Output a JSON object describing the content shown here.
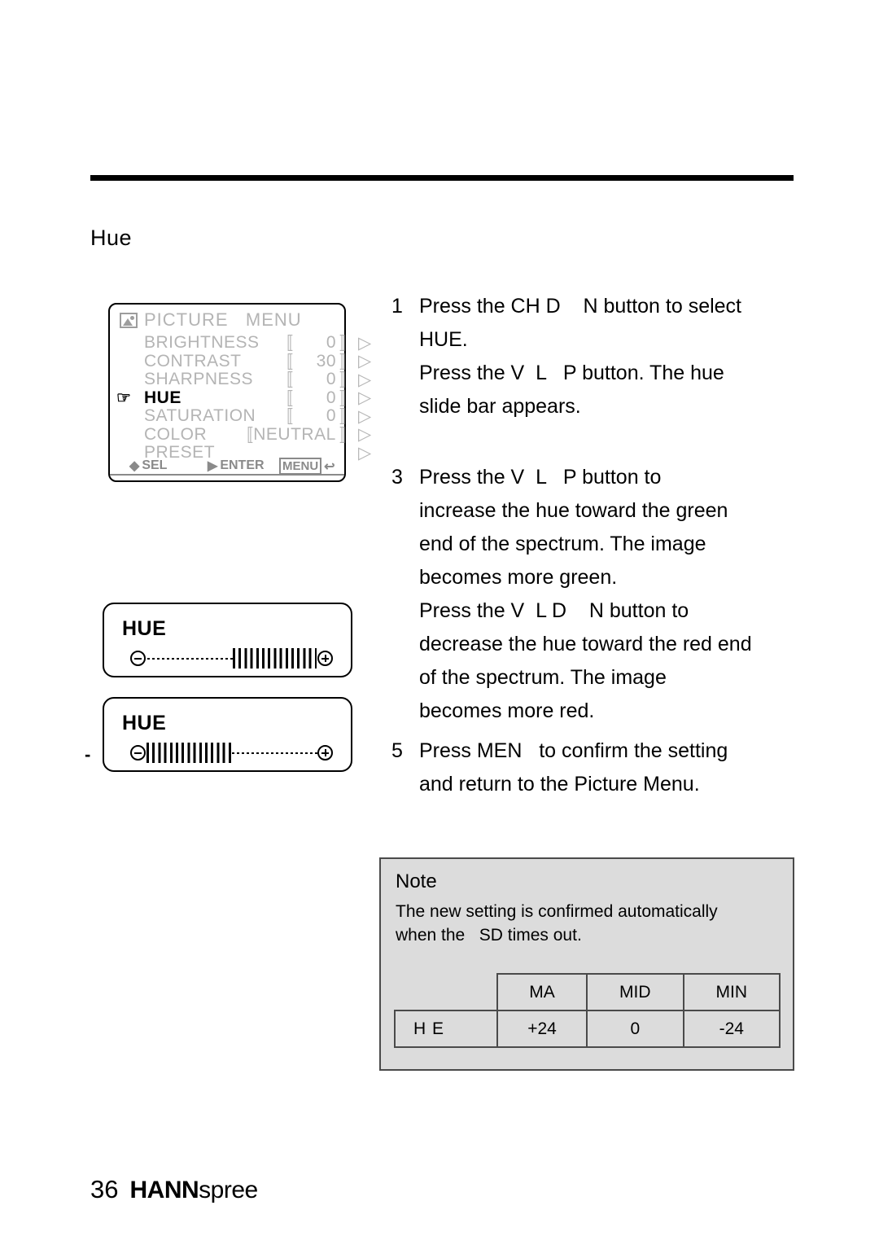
{
  "page": {
    "section_title": "Hue",
    "page_number": "36",
    "brand_bold": "HANN",
    "brand_light": "spree"
  },
  "osd": {
    "icon": "picture-menu-icon",
    "title": "PICTURE   MENU",
    "bracket_left": "〚",
    "bracket_right": "〛",
    "arrow": "▷",
    "cursor_glyph": "☞",
    "rows": [
      {
        "label": "BRIGHTNESS",
        "value": "0",
        "selected": false
      },
      {
        "label": "CONTRAST",
        "value": "30",
        "selected": false
      },
      {
        "label": "SHARPNESS",
        "value": "0",
        "selected": false
      },
      {
        "label": "HUE",
        "value": "0",
        "selected": true
      },
      {
        "label": "SATURATION",
        "value": "0",
        "selected": false
      },
      {
        "label": "COLOR",
        "value": "NEUTRAL",
        "selected": false,
        "wide": true
      },
      {
        "label": "PRESET",
        "value": "",
        "selected": false,
        "novalue": true
      }
    ],
    "footer": {
      "sel_icon": "◆",
      "sel_label": "SEL",
      "enter_icon": "▶",
      "enter_label": "ENTER",
      "menu_chip": "MENU",
      "back_icon": "↩"
    }
  },
  "slidebars": [
    {
      "label": "HUE",
      "minus_outside": "",
      "fill_from": "right",
      "fill_percent": 50
    },
    {
      "label": "HUE",
      "minus_outside": "-",
      "fill_from": "left",
      "fill_percent": 50
    }
  ],
  "steps": [
    {
      "number": "1",
      "text": "Press the CH D    N button to select\nHUE.\nPress the V  L   P button. The hue\nslide bar appears."
    },
    {
      "number": "3",
      "text": "Press the V  L   P button to\nincrease the hue toward the green\nend of the spectrum. The image\nbecomes more green.\nPress the V  L D    N button to\ndecrease the hue toward the red end\nof the spectrum. The image\nbecomes more red."
    },
    {
      "number": "5",
      "text": "Press MEN   to confirm the setting\nand return to the Picture Menu."
    }
  ],
  "note": {
    "title": "Note",
    "text": "The new setting is confirmed automatically\nwhen the   SD times out.",
    "table": {
      "headers": [
        "",
        "MA",
        "MID",
        "MIN"
      ],
      "rows": [
        {
          "label": "H  E",
          "values": [
            "+24",
            "0",
            "-24"
          ]
        }
      ]
    }
  },
  "colors": {
    "note_bg": "#dcdcdc",
    "note_border": "#4a4a4a",
    "osd_dim_text": "#b4b4b4",
    "osd_footer_text": "#8a8a8a",
    "rule": "#000000"
  }
}
